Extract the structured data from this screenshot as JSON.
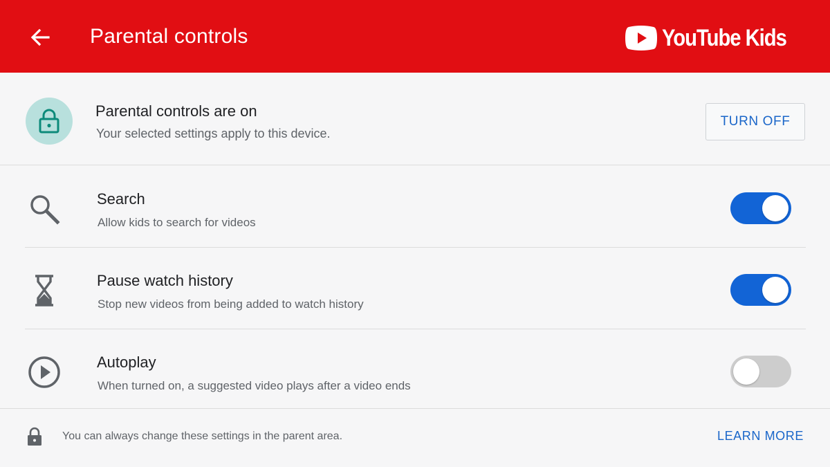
{
  "header": {
    "title": "Parental controls",
    "back_icon": "arrow-left-icon",
    "logo_text": "YouTube Kids",
    "background": "#e10e13"
  },
  "status": {
    "icon": "lock-icon",
    "title": "Parental controls are on",
    "subtitle": "Your selected settings apply to this device.",
    "button_label": "TURN OFF"
  },
  "settings": [
    {
      "icon": "search-icon",
      "title": "Search",
      "subtitle": "Allow kids to search for videos",
      "enabled": true
    },
    {
      "icon": "hourglass-icon",
      "title": "Pause watch history",
      "subtitle": "Stop new videos from being added to watch history",
      "enabled": true
    },
    {
      "icon": "play-circle-icon",
      "title": "Autoplay",
      "subtitle": "When turned on, a suggested video plays after a video ends",
      "enabled": false
    }
  ],
  "footer": {
    "icon": "lock-icon",
    "text": "You can always change these settings in the parent area.",
    "link_label": "LEARN MORE"
  },
  "colors": {
    "accent_blue": "#1264d6",
    "link_blue": "#1a66c9",
    "toggle_off": "#cdcdcd",
    "badge_teal": "#b8e0dd"
  }
}
